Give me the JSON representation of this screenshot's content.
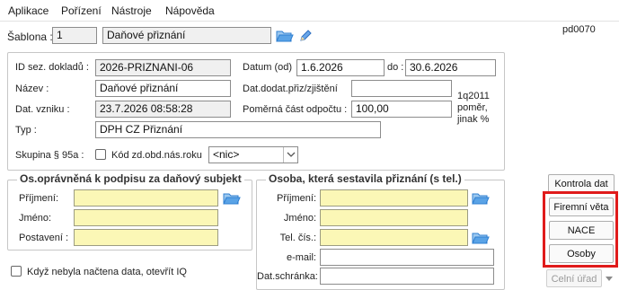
{
  "menu": {
    "items": [
      "Aplikace",
      "Pořízení",
      "Nástroje",
      "Nápověda"
    ]
  },
  "header": {
    "template_label": "Šablona :",
    "template_number": "1",
    "template_name": "Daňové přiznání",
    "code": "pd0070"
  },
  "document": {
    "id_label": "ID sez. dokladů :",
    "id_value": "2026-PRIZNANI-06",
    "name_label": "Název :",
    "name_value": "Daňové přiznání",
    "created_label": "Dat. vzniku :",
    "created_value": "23.7.2026 08:58:28",
    "type_label": "Typ :",
    "type_value": "DPH CZ Přiznání",
    "date_from_label": "Datum (od)",
    "date_from_value": "1.6.2026",
    "date_to_label": "do :",
    "date_to_value": "30.6.2026",
    "delivery_label": "Dat.dodat.přiz/zjištění",
    "delivery_value": "",
    "ratio_label": "Poměrná část odpočtu :",
    "ratio_value": "100,00",
    "ratio_note_line1": "1q2011",
    "ratio_note_line2": "poměr,",
    "ratio_note_line3": "jinak %",
    "group95_label": "Skupina § 95a :",
    "group95_checkbox_label": "Kód zd.obd.nás.roku",
    "group95_select": "<nic>"
  },
  "signatory": {
    "title": "Os.oprávněná k podpisu za daňový subjekt",
    "surname_label": "Příjmení:",
    "surname_value": "",
    "firstname_label": "Jméno:",
    "firstname_value": "",
    "position_label": "Postavení :",
    "position_value": ""
  },
  "preparer": {
    "title": "Osoba, která sestavila přiznání (s tel.)",
    "surname_label": "Příjmení:",
    "surname_value": "",
    "firstname_label": "Jméno:",
    "firstname_value": "",
    "phone_label": "Tel. čís.:",
    "phone_value": "",
    "email_label": "e-mail:",
    "email_value": "",
    "databox_label": "Dat.schránka:",
    "databox_value": ""
  },
  "footer": {
    "iq_checkbox_label": "Když nebyla načtena data, otevřít IQ"
  },
  "side_buttons": {
    "check_data": "Kontrola dat",
    "company_sentence": "Firemní věta",
    "nace": "NACE",
    "persons": "Osoby",
    "customs_office": "Celní úřad"
  },
  "colors": {
    "required_field": "#fbf7b6",
    "highlight_frame": "#e01b1b",
    "folder_icon": "#2f7fd1"
  }
}
